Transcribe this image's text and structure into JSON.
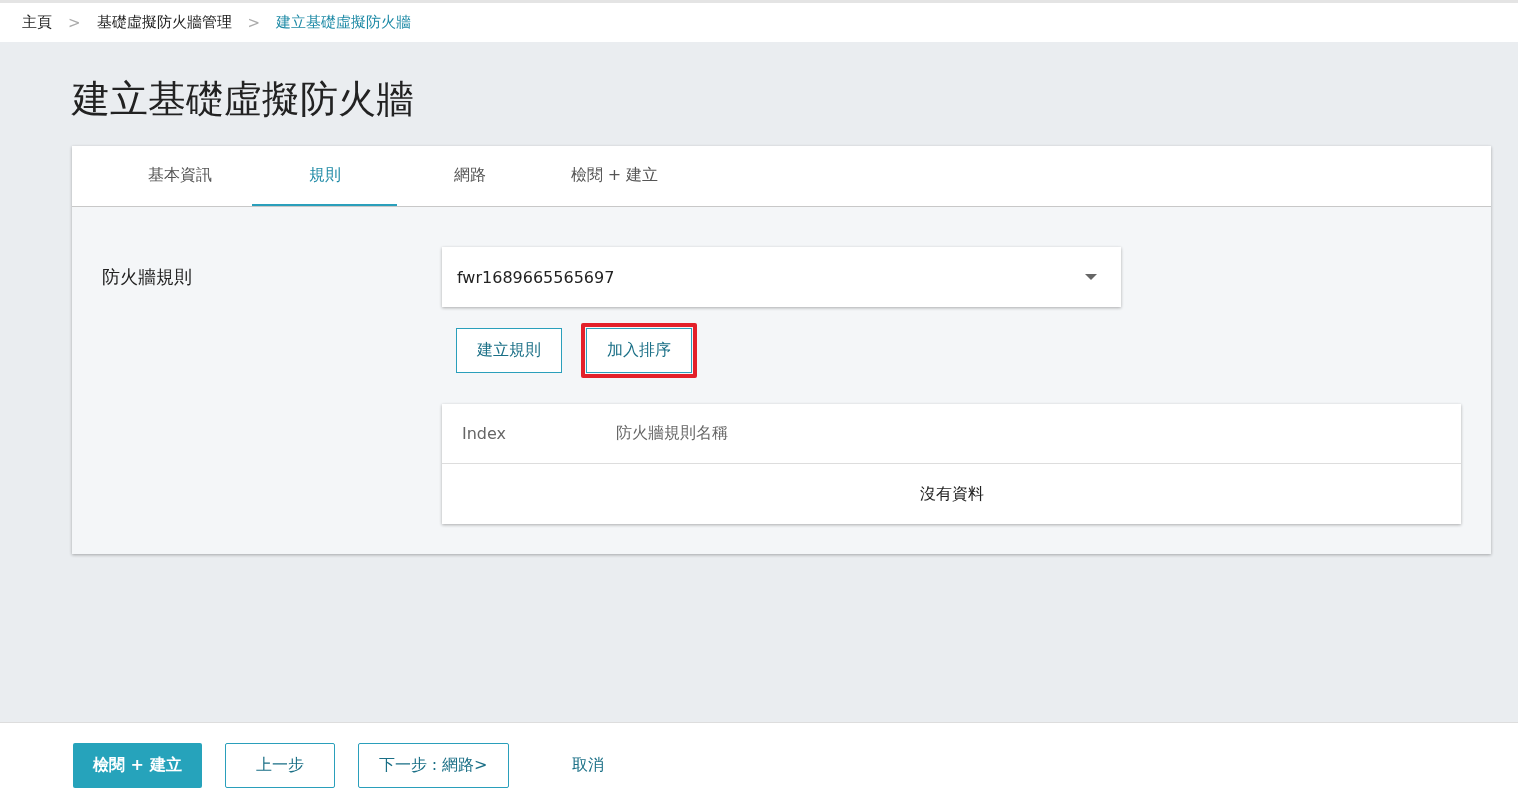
{
  "breadcrumb": [
    {
      "label": "主頁",
      "selected": false
    },
    {
      "label": "基礎虛擬防火牆管理",
      "selected": false
    },
    {
      "label": "建立基礎虛擬防火牆",
      "selected": true
    }
  ],
  "breadcrumb_separator": ">",
  "title": "建立基礎虛擬防火牆",
  "tabs": [
    {
      "label": "基本資訊",
      "selected": false
    },
    {
      "label": "規則",
      "selected": true
    },
    {
      "label": "網路",
      "selected": false
    },
    {
      "label": "檢閱 + 建立",
      "selected": false
    }
  ],
  "form": {
    "label": "防火牆規則",
    "select": {
      "value": "fwr1689665565697"
    },
    "buttons": [
      {
        "label": "建立規則",
        "highlighted": false
      },
      {
        "label": "加入排序",
        "highlighted": true
      }
    ],
    "table": {
      "columns": [
        "Index",
        "防火牆規則名稱"
      ],
      "empty_text": "沒有資料"
    }
  },
  "footer_buttons": [
    {
      "label": "檢閱 + 建立",
      "kind": "primary"
    },
    {
      "label": "上一步",
      "kind": "outline"
    },
    {
      "label": "下一步 : 網路>",
      "kind": "outline"
    },
    {
      "label": "取消",
      "kind": "text"
    }
  ]
}
